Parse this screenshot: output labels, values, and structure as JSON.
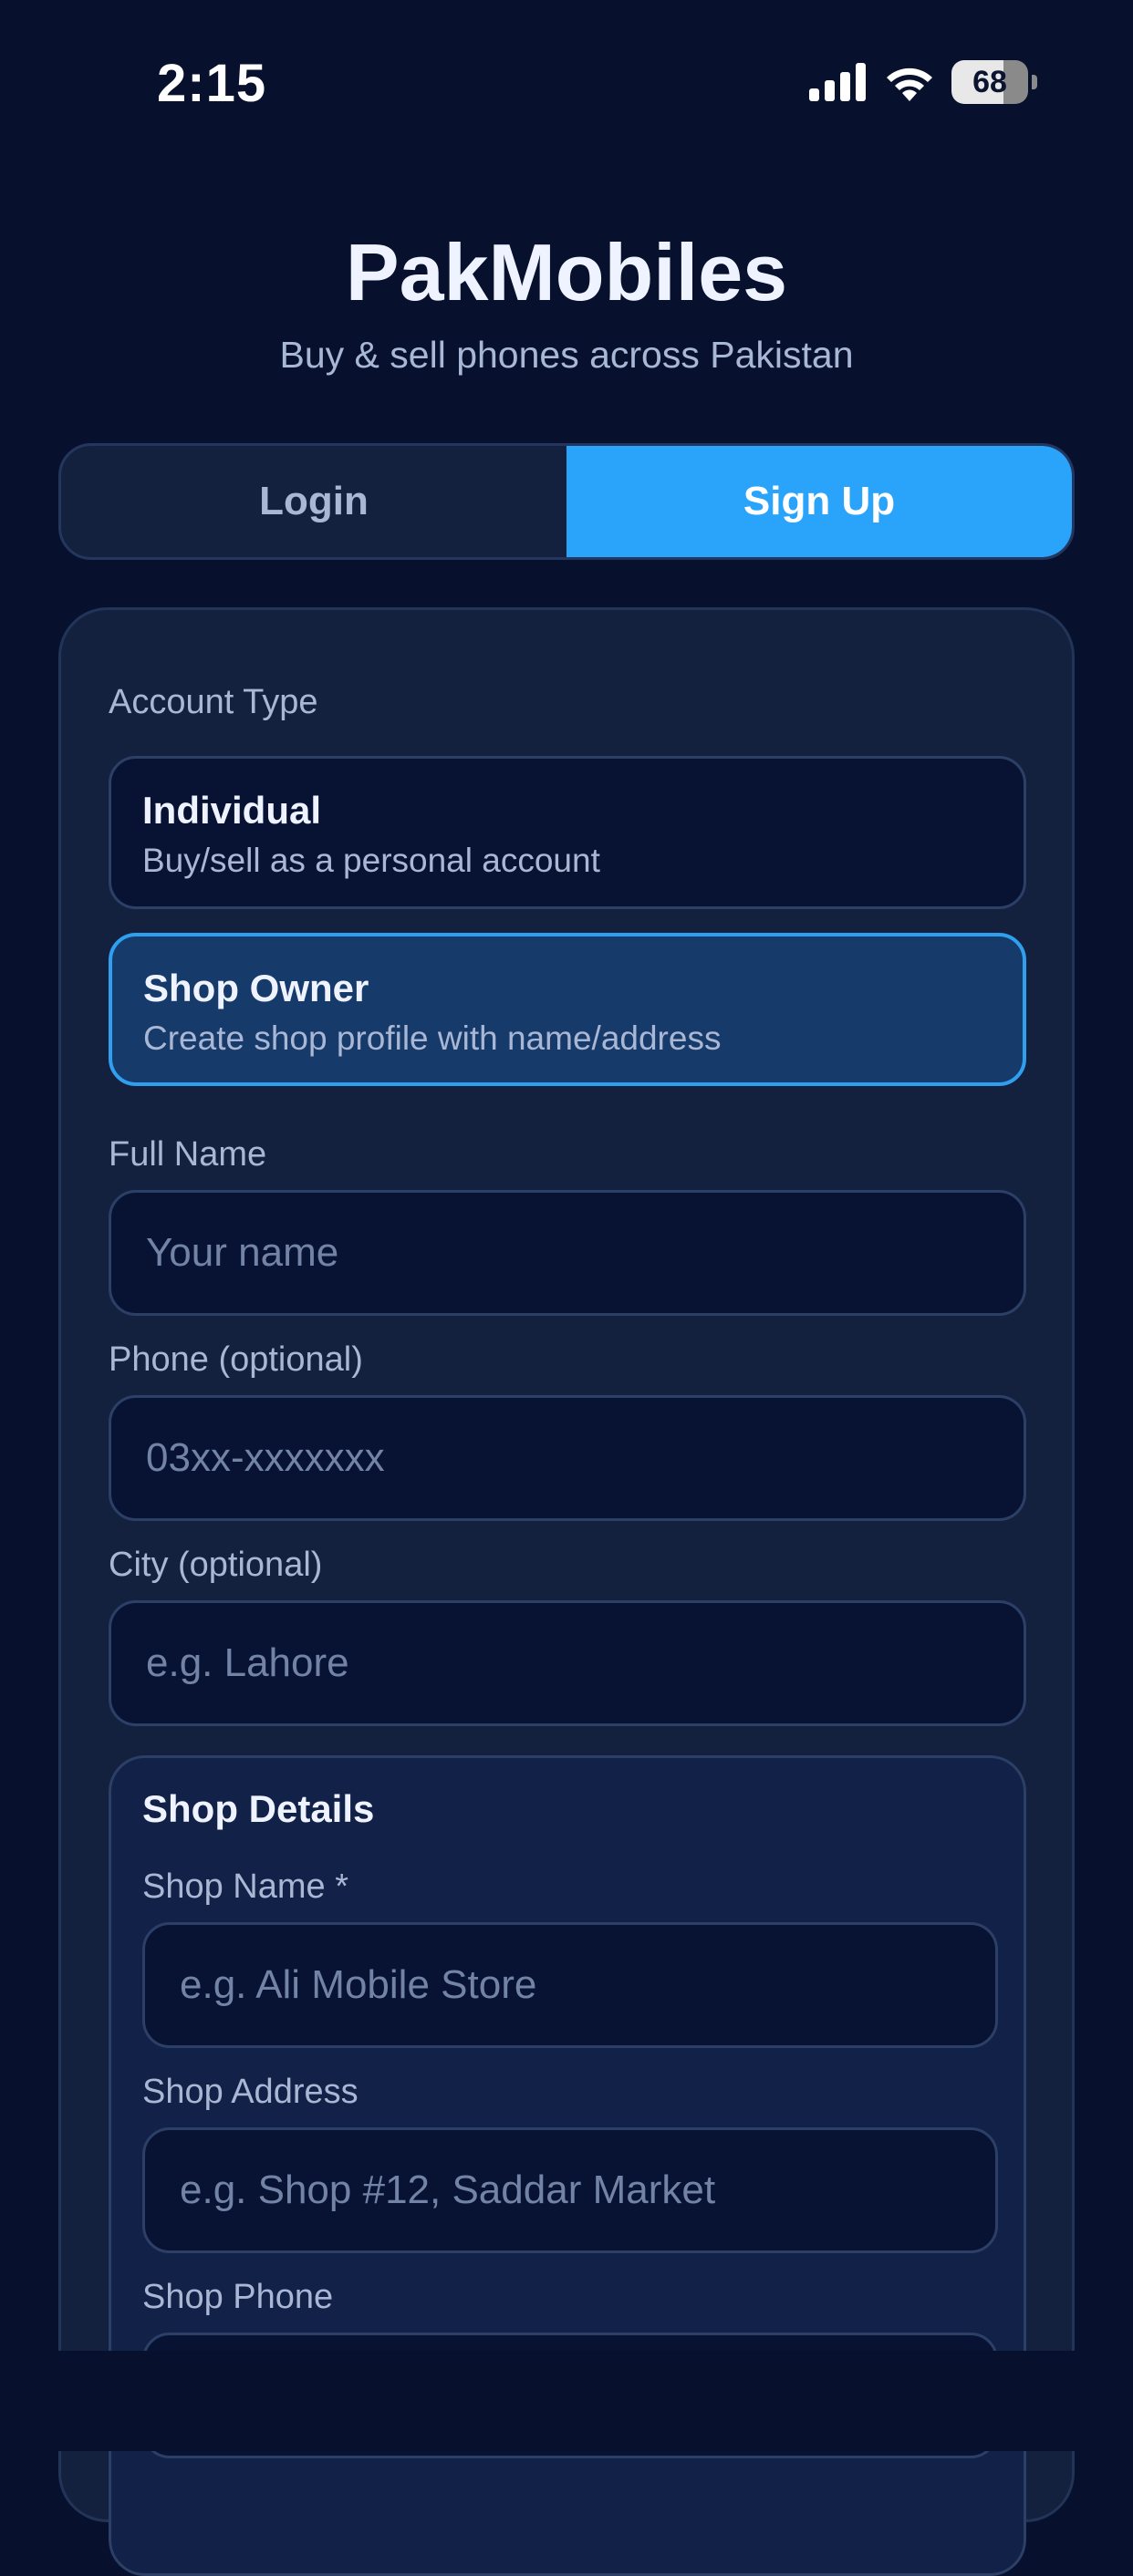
{
  "status_bar": {
    "time": "2:15",
    "battery": "68",
    "icons": [
      "signal-icon",
      "wifi-icon",
      "battery-icon"
    ]
  },
  "header": {
    "title": "PakMobiles",
    "subtitle": "Buy & sell phones across Pakistan"
  },
  "tabs": {
    "login": "Login",
    "signup": "Sign Up",
    "active": "signup"
  },
  "form": {
    "account_type_label": "Account Type",
    "options": [
      {
        "title": "Individual",
        "desc": "Buy/sell as a personal account",
        "selected": false
      },
      {
        "title": "Shop Owner",
        "desc": "Create shop profile with name/address",
        "selected": true
      }
    ],
    "full_name": {
      "label": "Full Name",
      "placeholder": "Your name",
      "value": ""
    },
    "phone": {
      "label": "Phone (optional)",
      "placeholder": "03xx-xxxxxxx",
      "value": ""
    },
    "city": {
      "label": "City (optional)",
      "placeholder": "e.g. Lahore",
      "value": ""
    },
    "shop": {
      "title": "Shop Details",
      "name": {
        "label": "Shop Name *",
        "placeholder": "e.g. Ali Mobile Store",
        "value": ""
      },
      "address": {
        "label": "Shop Address",
        "placeholder": "e.g. Shop #12, Saddar Market",
        "value": ""
      },
      "phone": {
        "label": "Shop Phone",
        "placeholder": "",
        "value": ""
      }
    }
  },
  "colors": {
    "background": "#07112d",
    "card": "#13213f",
    "accent": "#2aa3fb",
    "selected_option": "#163a6a"
  }
}
